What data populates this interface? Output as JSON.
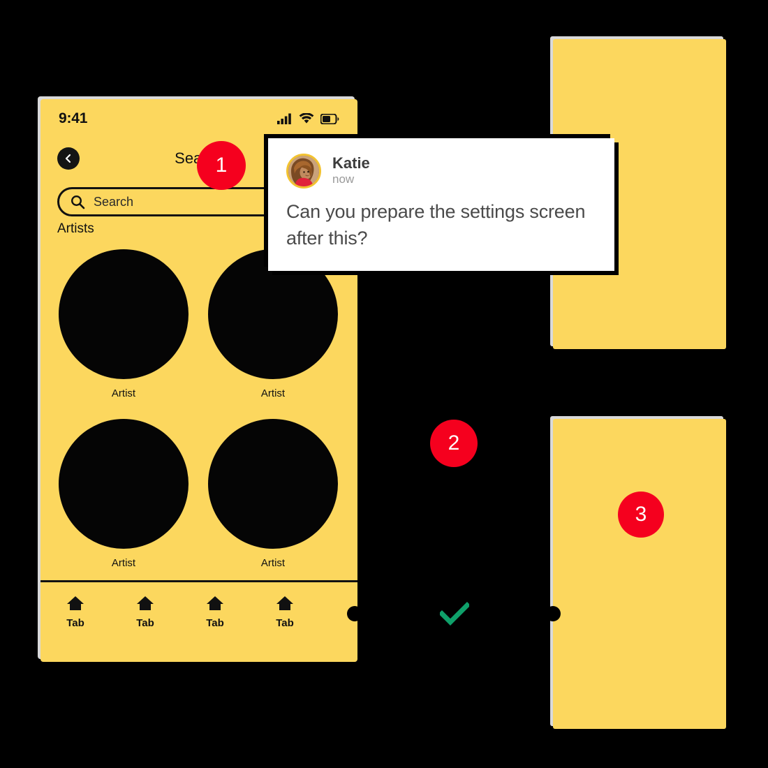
{
  "colors": {
    "background": "#000000",
    "screen_yellow": "#FCD75E",
    "badge_red": "#F5001E",
    "check_green": "#0FA06A",
    "card_white": "#FFFFFF",
    "ink_black": "#111111",
    "avatar_ring_gold": "#F2C230"
  },
  "phone_screen": {
    "status_bar": {
      "time": "9:41",
      "cellular_icon": "cellular-bars-icon",
      "wifi_icon": "wifi-icon",
      "battery_icon": "battery-icon"
    },
    "nav": {
      "back_icon": "chevron-left-icon",
      "title": "Search"
    },
    "search": {
      "icon": "search-icon",
      "placeholder": "Search",
      "value": ""
    },
    "section_label": "Artists",
    "artists": [
      {
        "name": "Artist"
      },
      {
        "name": "Artist"
      },
      {
        "name": "Artist"
      },
      {
        "name": "Artist"
      }
    ],
    "tabs": [
      {
        "label": "Tab",
        "icon": "home-icon"
      },
      {
        "label": "Tab",
        "icon": "home-icon"
      },
      {
        "label": "Tab",
        "icon": "home-icon"
      },
      {
        "label": "Tab",
        "icon": "home-icon"
      }
    ]
  },
  "notification": {
    "avatar_icon": "user-photo-avatar",
    "sender": "Katie",
    "timestamp": "now",
    "message": "Can you prepare the settings screen after this?"
  },
  "steps": [
    {
      "number": "1"
    },
    {
      "number": "2"
    },
    {
      "number": "3"
    }
  ],
  "flow": {
    "check_icon": "check-mark-icon",
    "connector_dot_icon": "connector-dot-icon"
  },
  "artboards": {
    "top_right": {
      "title": ""
    },
    "bottom_right": {
      "title": ""
    }
  }
}
